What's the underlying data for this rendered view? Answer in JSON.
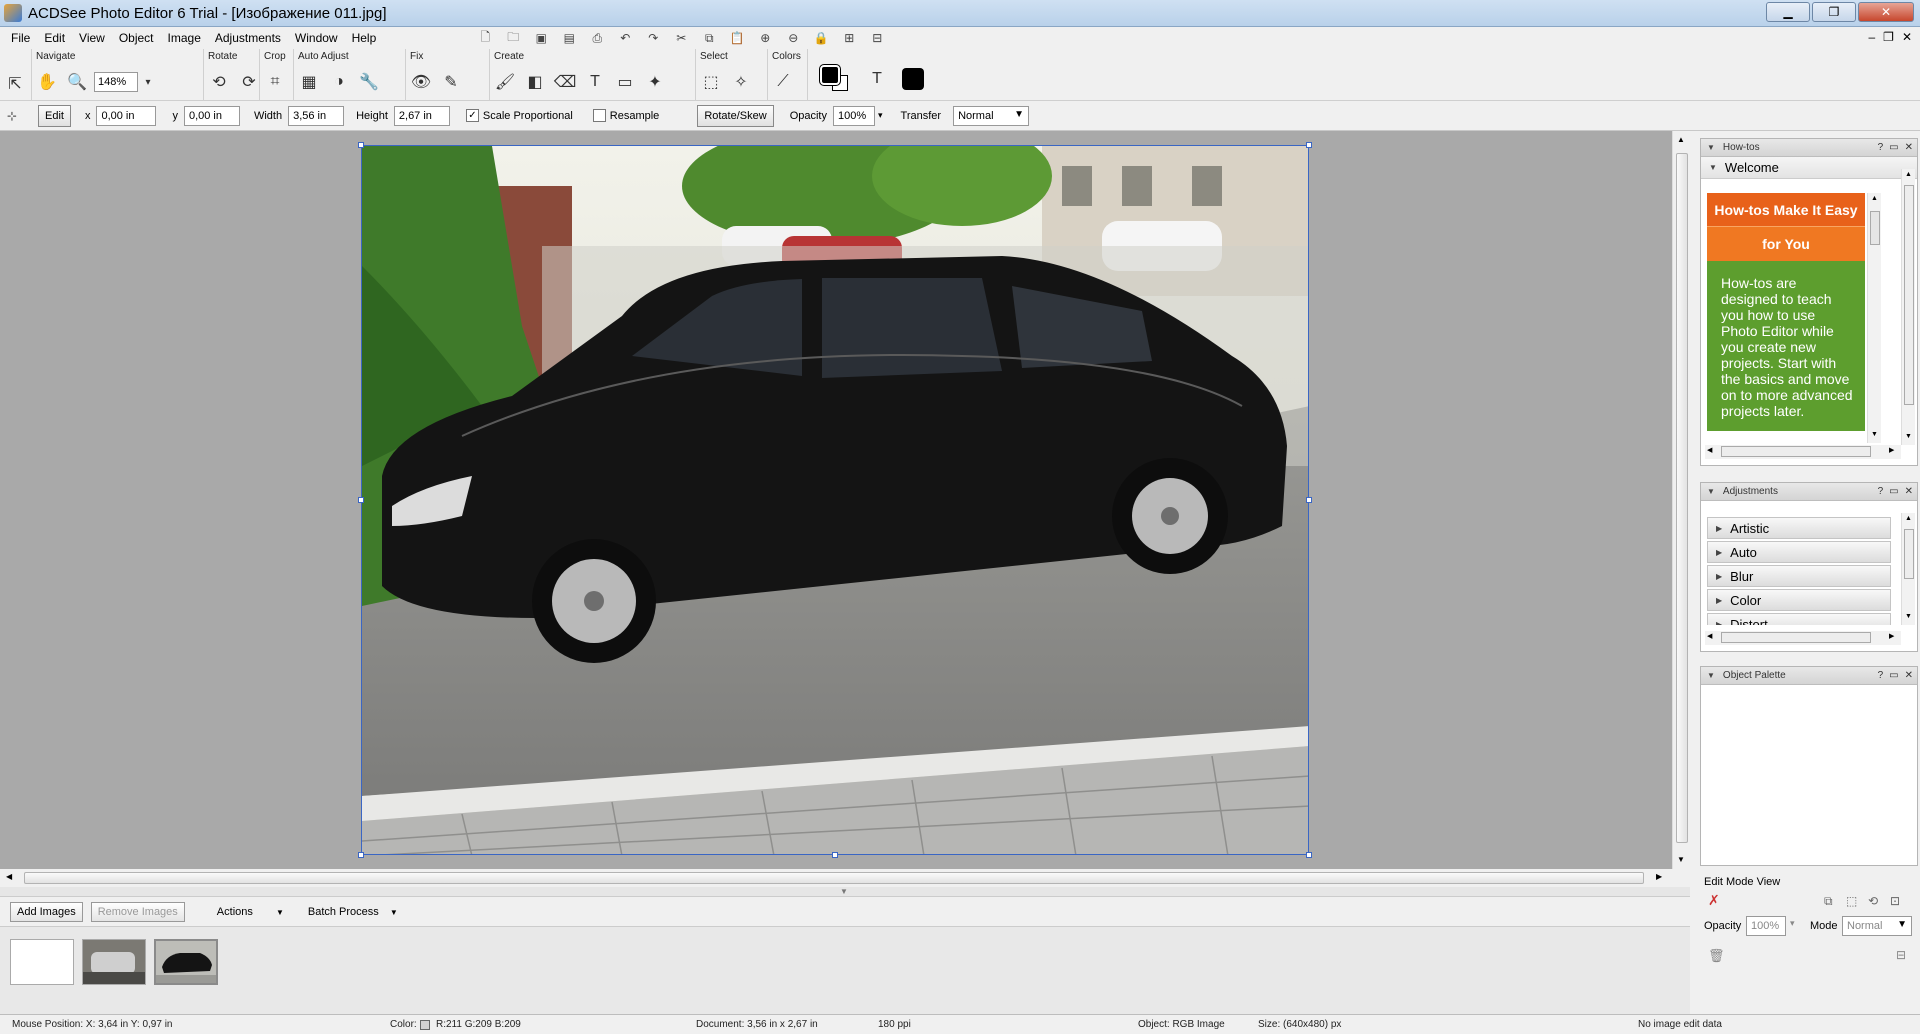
{
  "window": {
    "title": "ACDSee Photo Editor 6 Trial - [Изображение 011.jpg]",
    "minimize": "▁",
    "maximize": "❐",
    "close": "✕"
  },
  "menu": [
    "File",
    "Edit",
    "View",
    "Object",
    "Image",
    "Adjustments",
    "Window",
    "Help"
  ],
  "mdi": {
    "minimize": "–",
    "restore": "❐",
    "close": "✕"
  },
  "toolbar": {
    "groups": {
      "navigate": "Navigate",
      "rotate": "Rotate",
      "crop": "Crop",
      "auto_adjust": "Auto Adjust",
      "fix": "Fix",
      "create": "Create",
      "select": "Select",
      "colors": "Colors"
    },
    "zoom": "148%"
  },
  "options": {
    "edit_label": "Edit",
    "x_label": "x",
    "x_value": "0,00 in",
    "y_label": "y",
    "y_value": "0,00 in",
    "width_label": "Width",
    "width_value": "3,56 in",
    "height_label": "Height",
    "height_value": "2,67 in",
    "scale_proportional": "Scale Proportional",
    "resample": "Resample",
    "rotate_skew": "Rotate/Skew",
    "opacity_label": "Opacity",
    "opacity_value": "100%",
    "transfer_label": "Transfer",
    "transfer_value": "Normal"
  },
  "basket": {
    "add_images": "Add Images",
    "remove_images": "Remove Images",
    "actions": "Actions",
    "batch_process": "Batch Process"
  },
  "status": {
    "mouse": "Mouse Position: X: 3,64 in    Y: 0,97 in",
    "color": "Color:",
    "rgb": "R:211  G:209  B:209",
    "document": "Document: 3,56 in x 2,67 in",
    "ppi": "180 ppi",
    "object": "Object: RGB Image",
    "size": "Size: (640x480) px",
    "edit_data": "No image edit data"
  },
  "howtos": {
    "title": "How-tos",
    "welcome": "Welcome",
    "banner1": "How-tos Make It Easy",
    "banner2": "for You",
    "body": "How-tos are designed to teach you how to use Photo Editor while you create new projects. Start with the basics and move on to more advanced projects later."
  },
  "adjustments": {
    "title": "Adjustments",
    "items": [
      "Artistic",
      "Auto",
      "Blur",
      "Color",
      "Distort"
    ]
  },
  "object_palette": {
    "title": "Object Palette"
  },
  "edit_mode": {
    "title": "Edit Mode View",
    "opacity_label": "Opacity",
    "opacity_value": "100%",
    "mode_label": "Mode",
    "mode_value": "Normal"
  }
}
